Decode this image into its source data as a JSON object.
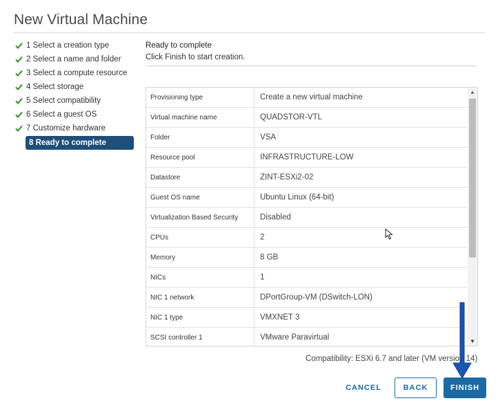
{
  "dialog": {
    "title": "New Virtual Machine"
  },
  "steps": [
    {
      "label": "1 Select a creation type",
      "done": true
    },
    {
      "label": "2 Select a name and folder",
      "done": true
    },
    {
      "label": "3 Select a compute resource",
      "done": true
    },
    {
      "label": "4 Select storage",
      "done": true
    },
    {
      "label": "5 Select compatibility",
      "done": true
    },
    {
      "label": "6 Select a guest OS",
      "done": true
    },
    {
      "label": "7 Customize hardware",
      "done": true
    },
    {
      "label": "8 Ready to complete",
      "done": false,
      "current": true
    }
  ],
  "content": {
    "heading": "Ready to complete",
    "subtext": "Click Finish to start creation."
  },
  "summary": [
    {
      "label": "Provisioning type",
      "value": "Create a new virtual machine"
    },
    {
      "label": "Virtual machine name",
      "value": "QUADSTOR-VTL"
    },
    {
      "label": "Folder",
      "value": "VSA"
    },
    {
      "label": "Resource pool",
      "value": "INFRASTRUCTURE-LOW"
    },
    {
      "label": "Datastore",
      "value": "ZINT-ESXi2-02"
    },
    {
      "label": "Guest OS name",
      "value": "Ubuntu Linux (64-bit)"
    },
    {
      "label": "Virtualization Based Security",
      "value": "Disabled"
    },
    {
      "label": "CPUs",
      "value": "2"
    },
    {
      "label": "Memory",
      "value": "8 GB"
    },
    {
      "label": "NICs",
      "value": "1"
    },
    {
      "label": "NIC 1 network",
      "value": "DPortGroup-VM (DSwitch-LON)"
    },
    {
      "label": "NIC 1 type",
      "value": "VMXNET 3"
    },
    {
      "label": "SCSI controller 1",
      "value": "VMware Paravirtual"
    }
  ],
  "compatibility": "Compatibility: ESXi 6.7 and later (VM version 14)",
  "buttons": {
    "cancel": "CANCEL",
    "back": "BACK",
    "finish": "FINISH"
  },
  "icons": {
    "step_done": "check-icon",
    "scroll_up": "triangle-up-icon",
    "scroll_down": "triangle-down-icon",
    "pointer": "mouse-cursor-icon",
    "annotation": "down-arrow-icon"
  },
  "colors": {
    "accent": "#1c6aa5",
    "current_step_bg": "#1f4e79",
    "check": "#3c8a2e",
    "annotation_arrow": "#1a56b0"
  }
}
